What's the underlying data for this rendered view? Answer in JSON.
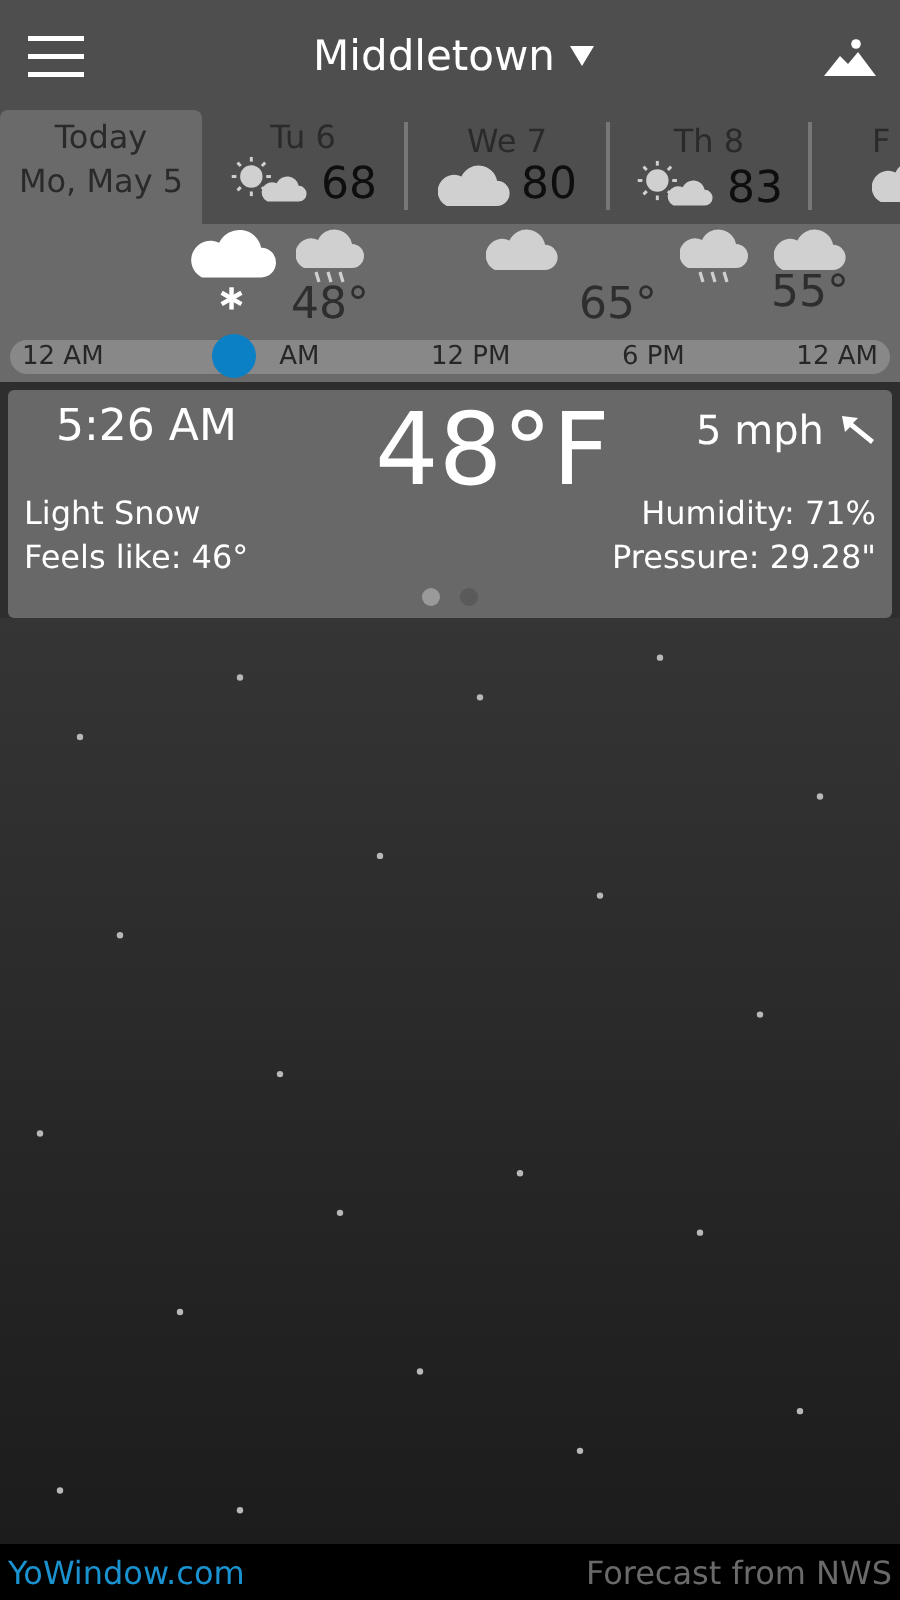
{
  "header": {
    "location": "Middletown"
  },
  "days": [
    {
      "label": "Today",
      "date": "Mo, May 5",
      "selected": true
    },
    {
      "label": "Tu 6",
      "kind": "sun-cloud",
      "temp": "68",
      "selected": false
    },
    {
      "label": "We 7",
      "kind": "cloud",
      "temp": "80",
      "selected": false
    },
    {
      "label": "Th 8",
      "kind": "sun-cloud",
      "temp": "83",
      "selected": false
    },
    {
      "label": "F",
      "kind": "cloud",
      "selected": false
    }
  ],
  "hourly": [
    {
      "kind": "snow",
      "current": true
    },
    {
      "kind": "rain",
      "temp": "48°",
      "current": false
    },
    {
      "kind": "cloud",
      "current": false
    },
    {
      "temp": "65°"
    },
    {
      "kind": "rain",
      "current": false
    },
    {
      "kind": "cloud",
      "temp": "55°",
      "current": false
    }
  ],
  "timeline": {
    "labels": [
      "12 AM",
      "AM",
      "12 PM",
      "6 PM",
      "12 AM"
    ],
    "level": 0.255
  },
  "current": {
    "time": "5:26 AM",
    "temperature": "48°F",
    "wind": "5 mph",
    "condition": "Light Snow",
    "feels_like": "Feels like: 46°",
    "humidity": "Humidity: 71%",
    "pressure": "Pressure: 29.28\"",
    "pages": [
      {
        "selected": true
      },
      {
        "selected": false
      }
    ]
  },
  "footer": {
    "link": "YoWindow.com",
    "source": "Forecast from NWS"
  }
}
